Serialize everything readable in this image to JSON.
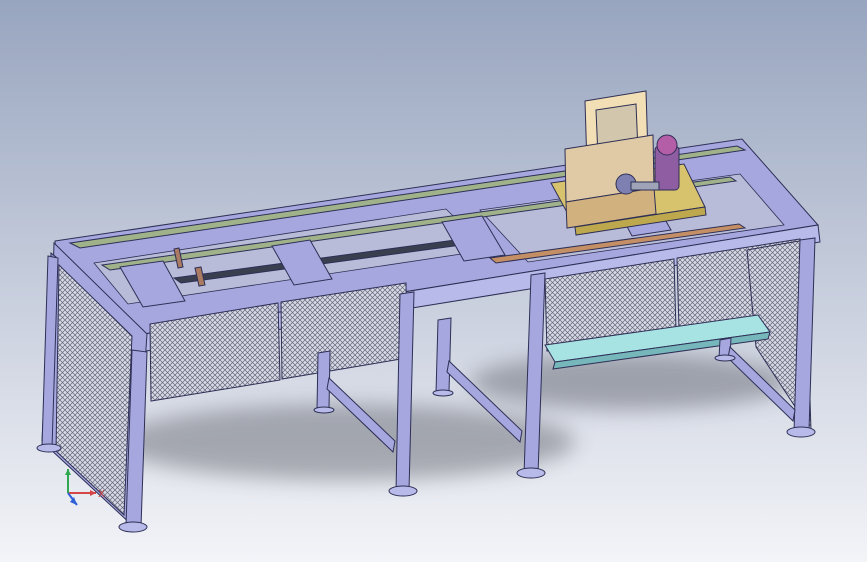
{
  "viewport": {
    "background_top": "#98a5bf",
    "background_bottom": "#f3f4f8"
  },
  "triad": {
    "x_label": "X",
    "y_label": "",
    "z_label": "",
    "x_color": "#d64545",
    "y_color": "#2fa84f",
    "z_color": "#2f5fd6"
  },
  "model": {
    "frame_color": "#a6a7df",
    "frame_edge": "#2e2f55",
    "rail_color": "#9fb28a",
    "mesh_color": "#6f7385",
    "carriage_color": "#d7c26d",
    "motor_color": "#8f5ea2",
    "tray_color": "#a8e3e4"
  }
}
